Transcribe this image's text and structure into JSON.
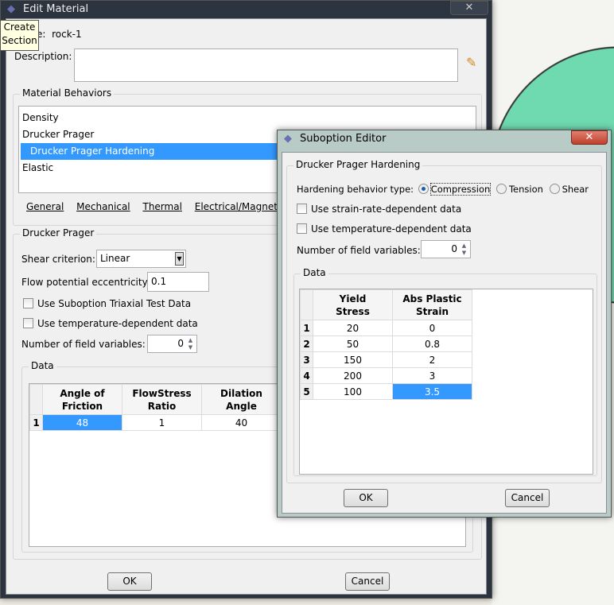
{
  "tooltip": {
    "line1": "Create",
    "line2": "Section"
  },
  "edit_material": {
    "title": "Edit Material",
    "name_label": "Name:",
    "name_value": "rock-1",
    "description_label": "Description:",
    "description_value": "",
    "behaviors_label": "Material Behaviors",
    "behaviors": [
      "Density",
      "Drucker Prager",
      "Drucker Prager Hardening",
      "Elastic"
    ],
    "menus": [
      "General",
      "Mechanical",
      "Thermal",
      "Electrical/Magnetic"
    ],
    "section_label": "Drucker Prager",
    "shear_criterion_label": "Shear criterion:",
    "shear_criterion_value": "Linear",
    "flow_eccentricity_label": "Flow potential eccentricity:",
    "flow_eccentricity_value": "0.1",
    "use_triaxial_label": "Use Suboption Triaxial Test Data",
    "use_temp_label": "Use temperature-dependent data",
    "field_vars_label": "Number of field variables:",
    "field_vars_value": "0",
    "data_label": "Data",
    "columns": [
      [
        "Angle of",
        "Friction"
      ],
      [
        "FlowStress",
        "Ratio"
      ],
      [
        "Dilation",
        "Angle"
      ]
    ],
    "rows": [
      [
        "1",
        "48",
        "1",
        "40"
      ]
    ],
    "ok": "OK",
    "cancel": "Cancel"
  },
  "suboption": {
    "title": "Suboption Editor",
    "section_label": "Drucker Prager Hardening",
    "hardening_label": "Hardening behavior type:",
    "options": [
      "Compression",
      "Tension",
      "Shear"
    ],
    "selected": "Compression",
    "strain_rate_label": "Use strain-rate-dependent data",
    "temp_label": "Use temperature-dependent data",
    "field_vars_label": "Number of field variables:",
    "field_vars_value": "0",
    "data_label": "Data",
    "columns": [
      [
        "Yield",
        "Stress"
      ],
      [
        "Abs Plastic",
        "Strain"
      ]
    ],
    "rows": [
      [
        "1",
        "20",
        "0"
      ],
      [
        "2",
        "50",
        "0.8"
      ],
      [
        "3",
        "150",
        "2"
      ],
      [
        "4",
        "200",
        "3"
      ],
      [
        "5",
        "100",
        "3.5"
      ]
    ],
    "ok": "OK",
    "cancel": "Cancel"
  }
}
